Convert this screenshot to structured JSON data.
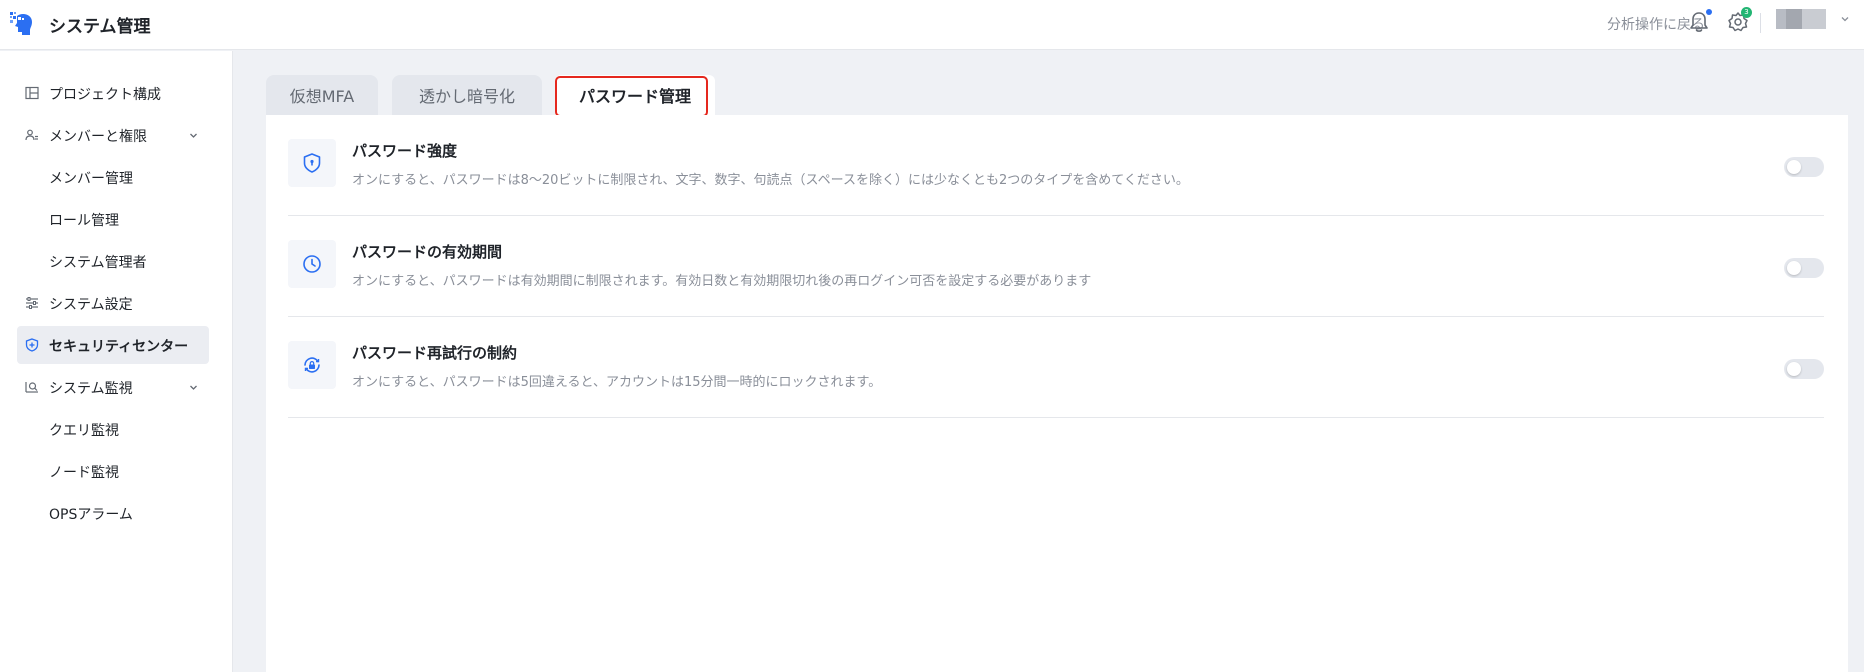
{
  "header": {
    "title": "システム管理",
    "back_link": "分析操作に戻る",
    "gear_badge": "3",
    "logo_icon": "brain-head-icon",
    "accent_color": "#2b6ff2"
  },
  "sidebar": {
    "items": [
      {
        "label": "プロジェクト構成",
        "icon": "layout-icon"
      },
      {
        "label": "メンバーと権限",
        "icon": "users-icon",
        "expanded": true
      },
      {
        "label": "メンバー管理"
      },
      {
        "label": "ロール管理"
      },
      {
        "label": "システム管理者"
      },
      {
        "label": "システム設定",
        "icon": "sliders-icon"
      },
      {
        "label": "セキュリティセンター",
        "icon": "shield-icon",
        "active": true
      },
      {
        "label": "システム監視",
        "icon": "monitor-search-icon",
        "expanded": true
      },
      {
        "label": "クエリ監視"
      },
      {
        "label": "ノード監視"
      },
      {
        "label": "OPSアラーム"
      }
    ]
  },
  "tabs": [
    {
      "label": "仮想MFA",
      "active": false
    },
    {
      "label": "透かし暗号化",
      "active": false
    },
    {
      "label": "パスワード管理",
      "active": true
    }
  ],
  "settings": [
    {
      "title": "パスワード強度",
      "description": "オンにすると、パスワードは8〜20ビットに制限され、文字、数字、句読点（スペースを除く）には少なくとも2つのタイプを含めてください。",
      "icon": "shield-lock-icon",
      "enabled": false
    },
    {
      "title": "パスワードの有効期間",
      "description": "オンにすると、パスワードは有効期間に制限されます。有効日数と有効期限切れ後の再ログイン可否を設定する必要があります",
      "icon": "clock-icon",
      "enabled": false
    },
    {
      "title": "パスワード再試行の制約",
      "description": "オンにすると、パスワードは5回違えると、アカウントは15分間一時的にロックされます。",
      "icon": "lock-refresh-icon",
      "enabled": false
    }
  ],
  "colors": {
    "highlight_border": "#e5281e",
    "icon_blue": "#2b6ff2",
    "badge_green": "#22b573"
  }
}
